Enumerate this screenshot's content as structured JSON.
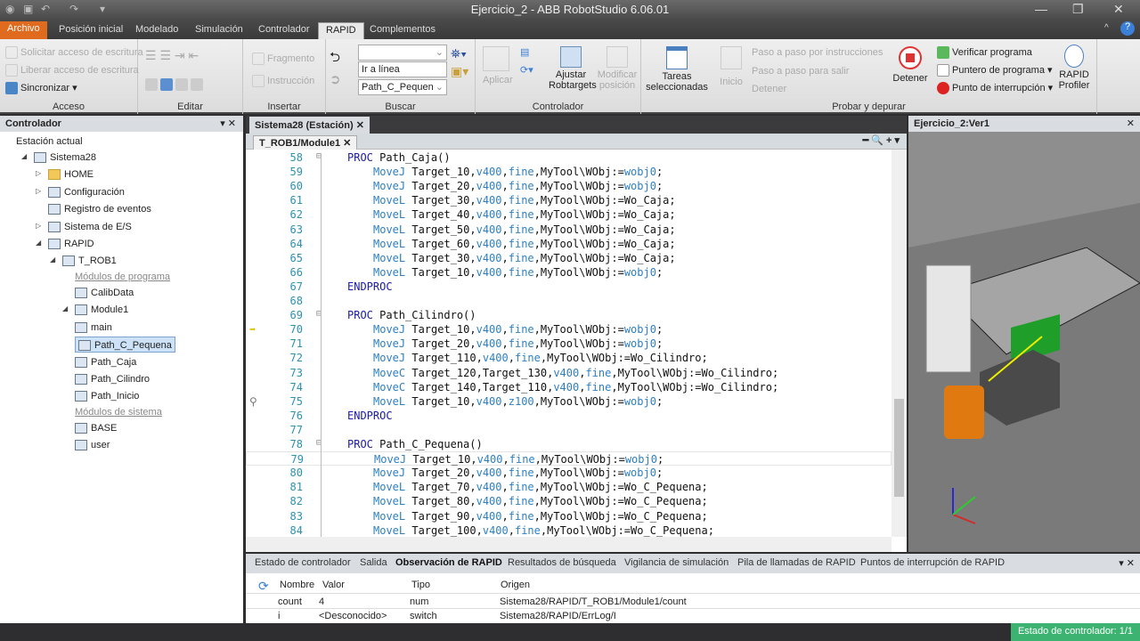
{
  "window": {
    "title": "Ejercicio_2 - ABB RobotStudio 6.06.01"
  },
  "ribbon_tabs": [
    "Archivo",
    "Posición inicial",
    "Modelado",
    "Simulación",
    "Controlador",
    "RAPID",
    "Complementos"
  ],
  "ribbon": {
    "acceso": {
      "label": "Acceso",
      "items": [
        "Solicitar acceso de escritura",
        "Liberar acceso de escritura",
        "Sincronizar"
      ]
    },
    "editar": {
      "label": "Editar"
    },
    "insertar": {
      "label": "Insertar",
      "items": [
        "Fragmento",
        "Instrucción"
      ]
    },
    "buscar": {
      "label": "Buscar",
      "goto_value": "Ir a línea",
      "proc_value": "Path_C_Pequen",
      "search_value": ""
    },
    "controlador": {
      "label": "Controlador",
      "items": [
        "Aplicar",
        "Ajustar Robtargets",
        "Modificar posición"
      ]
    },
    "probar": {
      "label": "Probar y depurar",
      "tareas": "Tareas seleccionadas",
      "inicio": "Inicio",
      "step_items": [
        "Paso a paso por instrucciones",
        "Paso a paso para salir",
        "Detener"
      ],
      "detener": "Detener",
      "right_items": [
        "Verificar programa",
        "Puntero de programa",
        "Punto de interrupción"
      ],
      "profiler": "RAPID Profiler"
    }
  },
  "left_panel": {
    "title": "Controlador",
    "tree": [
      {
        "label": "Estación actual",
        "level": 0,
        "icon": "none"
      },
      {
        "label": "Sistema28",
        "level": 0,
        "icon": "controller"
      },
      {
        "label": "HOME",
        "level": 1,
        "icon": "folder"
      },
      {
        "label": "Configuración",
        "level": 1,
        "icon": "config"
      },
      {
        "label": "Registro de eventos",
        "level": 1,
        "icon": "log"
      },
      {
        "label": "Sistema de E/S",
        "level": 1,
        "icon": "io"
      },
      {
        "label": "RAPID",
        "level": 1,
        "icon": "rapid"
      },
      {
        "label": "T_ROB1",
        "level": 2,
        "icon": "task"
      },
      {
        "label": "Módulos de programa",
        "level": 3,
        "icon": "category"
      },
      {
        "label": "CalibData",
        "level": 3,
        "icon": "module"
      },
      {
        "label": "Module1",
        "level": 3,
        "icon": "module"
      },
      {
        "label": "main",
        "level": 4,
        "icon": "proc"
      },
      {
        "label": "Path_C_Pequena",
        "level": 4,
        "icon": "proc",
        "selected": true
      },
      {
        "label": "Path_Caja",
        "level": 4,
        "icon": "proc"
      },
      {
        "label": "Path_Cilindro",
        "level": 4,
        "icon": "proc"
      },
      {
        "label": "Path_Inicio",
        "level": 4,
        "icon": "proc"
      },
      {
        "label": "Módulos de sistema",
        "level": 3,
        "icon": "category"
      },
      {
        "label": "BASE",
        "level": 3,
        "icon": "sysmodule"
      },
      {
        "label": "user",
        "level": 3,
        "icon": "sysmodule"
      }
    ]
  },
  "editor": {
    "doc_tab": "Sistema28 (Estación)",
    "module_tab": "T_ROB1/Module1",
    "lines": [
      {
        "n": "58",
        "i": 1,
        "p": [
          [
            "PROC ",
            "kw"
          ],
          [
            "Path_Caja()",
            "id"
          ]
        ]
      },
      {
        "n": "59",
        "i": 2,
        "p": [
          [
            "MoveJ ",
            "ins"
          ],
          [
            "Target_10,",
            "id"
          ],
          [
            "v400",
            "lit"
          ],
          [
            ",",
            "id"
          ],
          [
            "fine",
            "lit"
          ],
          [
            ",MyTool\\WObj:=",
            "id"
          ],
          [
            "wobj0",
            "lit"
          ],
          [
            ";",
            "id"
          ]
        ]
      },
      {
        "n": "60",
        "i": 2,
        "p": [
          [
            "MoveJ ",
            "ins"
          ],
          [
            "Target_20,",
            "id"
          ],
          [
            "v400",
            "lit"
          ],
          [
            ",",
            "id"
          ],
          [
            "fine",
            "lit"
          ],
          [
            ",MyTool\\WObj:=",
            "id"
          ],
          [
            "wobj0",
            "lit"
          ],
          [
            ";",
            "id"
          ]
        ]
      },
      {
        "n": "61",
        "i": 2,
        "p": [
          [
            "MoveL ",
            "ins"
          ],
          [
            "Target_30,",
            "id"
          ],
          [
            "v400",
            "lit"
          ],
          [
            ",",
            "id"
          ],
          [
            "fine",
            "lit"
          ],
          [
            ",MyTool\\WObj:=Wo_Caja;",
            "id"
          ]
        ]
      },
      {
        "n": "62",
        "i": 2,
        "p": [
          [
            "MoveL ",
            "ins"
          ],
          [
            "Target_40,",
            "id"
          ],
          [
            "v400",
            "lit"
          ],
          [
            ",",
            "id"
          ],
          [
            "fine",
            "lit"
          ],
          [
            ",MyTool\\WObj:=Wo_Caja;",
            "id"
          ]
        ]
      },
      {
        "n": "63",
        "i": 2,
        "p": [
          [
            "MoveL ",
            "ins"
          ],
          [
            "Target_50,",
            "id"
          ],
          [
            "v400",
            "lit"
          ],
          [
            ",",
            "id"
          ],
          [
            "fine",
            "lit"
          ],
          [
            ",MyTool\\WObj:=Wo_Caja;",
            "id"
          ]
        ]
      },
      {
        "n": "64",
        "i": 2,
        "p": [
          [
            "MoveL ",
            "ins"
          ],
          [
            "Target_60,",
            "id"
          ],
          [
            "v400",
            "lit"
          ],
          [
            ",",
            "id"
          ],
          [
            "fine",
            "lit"
          ],
          [
            ",MyTool\\WObj:=Wo_Caja;",
            "id"
          ]
        ]
      },
      {
        "n": "65",
        "i": 2,
        "p": [
          [
            "MoveL ",
            "ins"
          ],
          [
            "Target_30,",
            "id"
          ],
          [
            "v400",
            "lit"
          ],
          [
            ",",
            "id"
          ],
          [
            "fine",
            "lit"
          ],
          [
            ",MyTool\\WObj:=Wo_Caja;",
            "id"
          ]
        ]
      },
      {
        "n": "66",
        "i": 2,
        "p": [
          [
            "MoveL ",
            "ins"
          ],
          [
            "Target_10,",
            "id"
          ],
          [
            "v400",
            "lit"
          ],
          [
            ",",
            "id"
          ],
          [
            "fine",
            "lit"
          ],
          [
            ",MyTool\\WObj:=",
            "id"
          ],
          [
            "wobj0",
            "lit"
          ],
          [
            ";",
            "id"
          ]
        ]
      },
      {
        "n": "67",
        "i": 1,
        "p": [
          [
            "ENDPROC",
            "kw"
          ]
        ]
      },
      {
        "n": "68",
        "i": 0,
        "p": []
      },
      {
        "n": "69",
        "i": 1,
        "p": [
          [
            "PROC ",
            "kw"
          ],
          [
            "Path_Cilindro()",
            "id"
          ]
        ]
      },
      {
        "n": "70",
        "i": 2,
        "p": [
          [
            "MoveJ ",
            "ins"
          ],
          [
            "Target_10,",
            "id"
          ],
          [
            "v400",
            "lit"
          ],
          [
            ",",
            "id"
          ],
          [
            "fine",
            "lit"
          ],
          [
            ",MyTool\\WObj:=",
            "id"
          ],
          [
            "wobj0",
            "lit"
          ],
          [
            ";",
            "id"
          ]
        ],
        "marker": "pointer"
      },
      {
        "n": "71",
        "i": 2,
        "p": [
          [
            "MoveJ ",
            "ins"
          ],
          [
            "Target_20,",
            "id"
          ],
          [
            "v400",
            "lit"
          ],
          [
            ",",
            "id"
          ],
          [
            "fine",
            "lit"
          ],
          [
            ",MyTool\\WObj:=",
            "id"
          ],
          [
            "wobj0",
            "lit"
          ],
          [
            ";",
            "id"
          ]
        ]
      },
      {
        "n": "72",
        "i": 2,
        "p": [
          [
            "MoveJ ",
            "ins"
          ],
          [
            "Target_110,",
            "id"
          ],
          [
            "v400",
            "lit"
          ],
          [
            ",",
            "id"
          ],
          [
            "fine",
            "lit"
          ],
          [
            ",MyTool\\WObj:=Wo_Cilindro;",
            "id"
          ]
        ]
      },
      {
        "n": "73",
        "i": 2,
        "p": [
          [
            "MoveC ",
            "ins"
          ],
          [
            "Target_120,Target_130,",
            "id"
          ],
          [
            "v400",
            "lit"
          ],
          [
            ",",
            "id"
          ],
          [
            "fine",
            "lit"
          ],
          [
            ",MyTool\\WObj:=Wo_Cilindro;",
            "id"
          ]
        ]
      },
      {
        "n": "74",
        "i": 2,
        "p": [
          [
            "MoveC ",
            "ins"
          ],
          [
            "Target_140,Target_110,",
            "id"
          ],
          [
            "v400",
            "lit"
          ],
          [
            ",",
            "id"
          ],
          [
            "fine",
            "lit"
          ],
          [
            ",MyTool\\WObj:=Wo_Cilindro;",
            "id"
          ]
        ]
      },
      {
        "n": "75",
        "i": 2,
        "p": [
          [
            "MoveL ",
            "ins"
          ],
          [
            "Target_10,",
            "id"
          ],
          [
            "v400",
            "lit"
          ],
          [
            ",",
            "id"
          ],
          [
            "z100",
            "lit"
          ],
          [
            ",MyTool\\WObj:=",
            "id"
          ],
          [
            "wobj0",
            "lit"
          ],
          [
            ";",
            "id"
          ]
        ],
        "marker": "motion"
      },
      {
        "n": "76",
        "i": 1,
        "p": [
          [
            "ENDPROC",
            "kw"
          ]
        ]
      },
      {
        "n": "77",
        "i": 0,
        "p": []
      },
      {
        "n": "78",
        "i": 1,
        "p": [
          [
            "PROC ",
            "kw"
          ],
          [
            "Path_C_Pequena()",
            "id"
          ]
        ]
      },
      {
        "n": "79",
        "i": 2,
        "p": [
          [
            "MoveJ ",
            "ins"
          ],
          [
            "Target_10,",
            "id"
          ],
          [
            "v400",
            "lit"
          ],
          [
            ",",
            "id"
          ],
          [
            "fine",
            "lit"
          ],
          [
            ",MyTool\\WObj:=",
            "id"
          ],
          [
            "wobj0",
            "lit"
          ],
          [
            ";",
            "id"
          ]
        ],
        "current": true
      },
      {
        "n": "80",
        "i": 2,
        "p": [
          [
            "MoveJ ",
            "ins"
          ],
          [
            "Target_20,",
            "id"
          ],
          [
            "v400",
            "lit"
          ],
          [
            ",",
            "id"
          ],
          [
            "fine",
            "lit"
          ],
          [
            ",MyTool\\WObj:=",
            "id"
          ],
          [
            "wobj0",
            "lit"
          ],
          [
            ";",
            "id"
          ]
        ]
      },
      {
        "n": "81",
        "i": 2,
        "p": [
          [
            "MoveL ",
            "ins"
          ],
          [
            "Target_70,",
            "id"
          ],
          [
            "v400",
            "lit"
          ],
          [
            ",",
            "id"
          ],
          [
            "fine",
            "lit"
          ],
          [
            ",MyTool\\WObj:=Wo_C_Pequena;",
            "id"
          ]
        ]
      },
      {
        "n": "82",
        "i": 2,
        "p": [
          [
            "MoveL ",
            "ins"
          ],
          [
            "Target_80,",
            "id"
          ],
          [
            "v400",
            "lit"
          ],
          [
            ",",
            "id"
          ],
          [
            "fine",
            "lit"
          ],
          [
            ",MyTool\\WObj:=Wo_C_Pequena;",
            "id"
          ]
        ]
      },
      {
        "n": "83",
        "i": 2,
        "p": [
          [
            "MoveL ",
            "ins"
          ],
          [
            "Target_90,",
            "id"
          ],
          [
            "v400",
            "lit"
          ],
          [
            ",",
            "id"
          ],
          [
            "fine",
            "lit"
          ],
          [
            ",MyTool\\WObj:=Wo_C_Pequena;",
            "id"
          ]
        ]
      },
      {
        "n": "84",
        "i": 2,
        "p": [
          [
            "MoveL ",
            "ins"
          ],
          [
            "Target_100,",
            "id"
          ],
          [
            "v400",
            "lit"
          ],
          [
            ",",
            "id"
          ],
          [
            "fine",
            "lit"
          ],
          [
            ",MyTool\\WObj:=Wo_C_Pequena;",
            "id"
          ]
        ]
      }
    ]
  },
  "viewport": {
    "title": "Ejercicio_2:Ver1"
  },
  "bottom_panel": {
    "tabs": [
      "Estado de controlador",
      "Salida",
      "Observación de RAPID",
      "Resultados de búsqueda",
      "Vigilancia de simulación",
      "Pila de llamadas de RAPID",
      "Puntos de interrupción de RAPID"
    ],
    "active_tab": 2,
    "columns": [
      "Nombre",
      "Valor",
      "Tipo",
      "Origen"
    ],
    "rows": [
      [
        "count",
        "4",
        "num",
        "Sistema28/RAPID/T_ROB1/Module1/count"
      ],
      [
        "i",
        "<Desconocido>",
        "switch",
        "Sistema28/RAPID/ErrLog/I"
      ]
    ]
  },
  "status": {
    "controller_state": "Estado de controlador: 1/1"
  },
  "colors": {
    "accent_file": "#e06b1f",
    "status_green": "#3cb371",
    "keyword": "#1a1aa6",
    "instruction": "#2d7fc2"
  }
}
